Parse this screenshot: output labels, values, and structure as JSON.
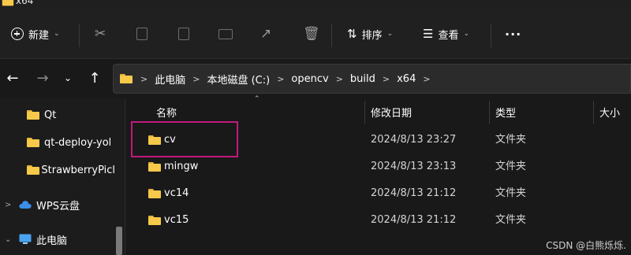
{
  "window": {
    "title": "x64"
  },
  "toolbar": {
    "new_label": "新建",
    "sort_label": "排序",
    "view_label": "查看",
    "more_label": "···"
  },
  "address": {
    "crumbs": [
      "此电脑",
      "本地磁盘 (C:)",
      "opencv",
      "build",
      "x64"
    ]
  },
  "sidebar": {
    "items": [
      {
        "label": "Qt",
        "icon": "folder-icon"
      },
      {
        "label": "qt-deploy-yol",
        "icon": "folder-icon"
      },
      {
        "label": "StrawberryPicl",
        "icon": "folder-icon"
      },
      {
        "label": "WPS云盘",
        "icon": "cloud-icon"
      },
      {
        "label": "此电脑",
        "icon": "computer-icon"
      }
    ]
  },
  "filelist": {
    "columns": [
      "名称",
      "修改日期",
      "类型",
      "大小"
    ],
    "rows": [
      {
        "name": "cv",
        "date": "2024/8/13 23:27",
        "type": "文件夹"
      },
      {
        "name": "mingw",
        "date": "2024/8/13 23:13",
        "type": "文件夹"
      },
      {
        "name": "vc14",
        "date": "2024/8/13 21:12",
        "type": "文件夹"
      },
      {
        "name": "vc15",
        "date": "2024/8/13 21:12",
        "type": "文件夹"
      }
    ]
  },
  "watermark": "CSDN @白熊烁烁.",
  "colors": {
    "background": "#1c1c1c",
    "folder": "#f6c94a",
    "highlight": "#c2187f"
  }
}
